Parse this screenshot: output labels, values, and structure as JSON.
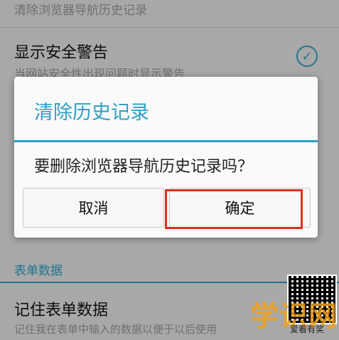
{
  "background": {
    "top_item_sub": "清除浏览器导航历史记录",
    "security_title": "显示安全警告",
    "security_sub": "当网站安全性出现问题时显示警告",
    "section_header": "表单数据",
    "form_title": "记住表单数据",
    "form_sub": "记住我在表单中输入的数据以便于以后使用"
  },
  "dialog": {
    "title": "清除历史记录",
    "message": "要删除浏览器导航历史记录吗？",
    "cancel_label": "取消",
    "ok_label": "确定"
  },
  "watermark": {
    "text": "学识网",
    "sub": "爱看有奖"
  },
  "colors": {
    "accent": "#2d9fc4",
    "highlight": "#d9321f"
  }
}
